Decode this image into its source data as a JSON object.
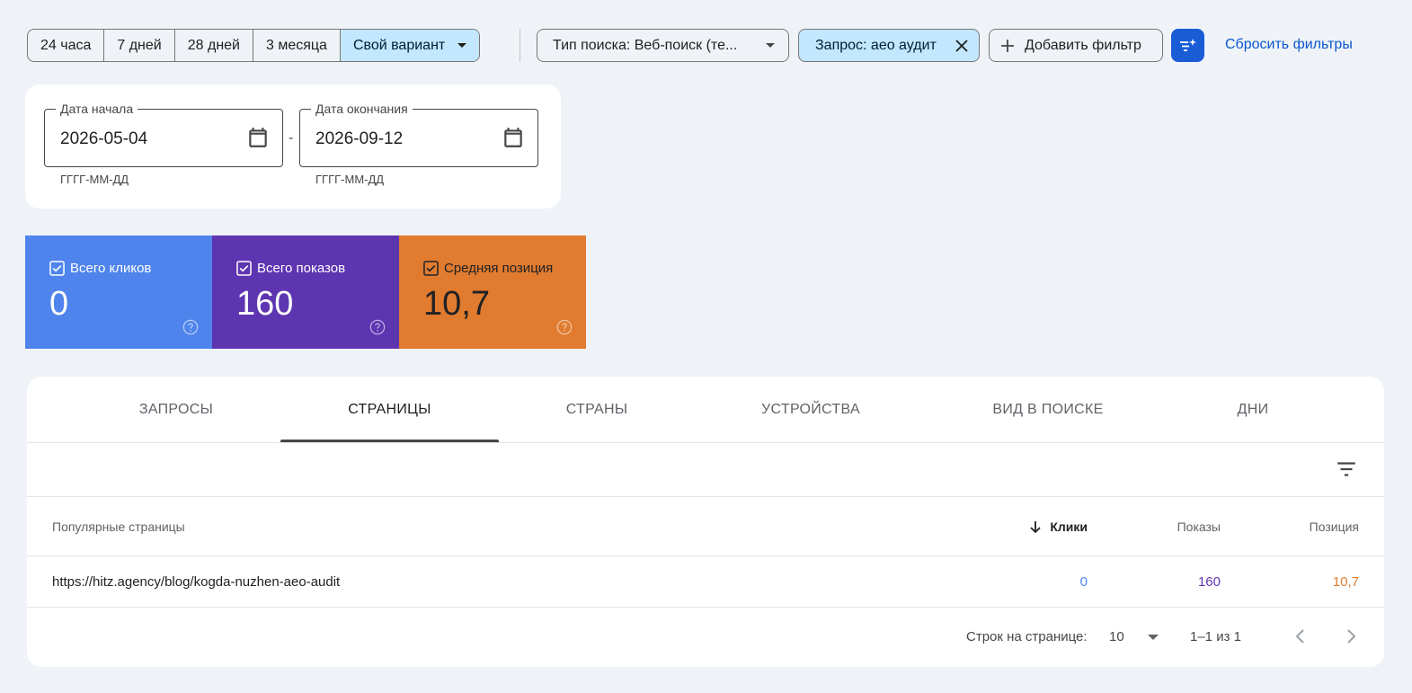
{
  "date_ranges": {
    "items": [
      "24 часа",
      "7 дней",
      "28 дней",
      "3 месяца"
    ],
    "custom_label": "Свой вариант"
  },
  "filters": {
    "search_type": "Тип поиска: Веб-поиск (те...",
    "query": "Запрос: аео аудит",
    "add_filter": "Добавить фильтр",
    "reset": "Сбросить фильтры"
  },
  "date_picker": {
    "start_label": "Дата начала",
    "start_value": "2026-05-04",
    "start_hint": "ГГГГ-ММ-ДД",
    "separator": "-",
    "end_label": "Дата окончания",
    "end_value": "2026-09-12",
    "end_hint": "ГГГГ-ММ-ДД"
  },
  "metrics": {
    "clicks": {
      "label": "Всего кликов",
      "value": "0",
      "color": "#4e84ec"
    },
    "impressions": {
      "label": "Всего показов",
      "value": "160",
      "color": "#5e35b1"
    },
    "position": {
      "label": "Средняя позиция",
      "value": "10,7",
      "color": "#e07b2f"
    }
  },
  "tabs": [
    "ЗАПРОСЫ",
    "СТРАНИЦЫ",
    "СТРАНЫ",
    "УСТРОЙСТВА",
    "ВИД В ПОИСКЕ",
    "ДНИ"
  ],
  "active_tab": "СТРАНИЦЫ",
  "table": {
    "columns": {
      "pages": "Популярные страницы",
      "clicks": "Клики",
      "impressions": "Показы",
      "position": "Позиция"
    },
    "rows": [
      {
        "url": "https://hitz.agency/blog/kogda-nuzhen-aeo-audit",
        "clicks": "0",
        "impressions": "160",
        "position": "10,7"
      }
    ]
  },
  "pagination": {
    "rows_label": "Строк на странице:",
    "rows_value": "10",
    "range": "1–1 из 1"
  }
}
